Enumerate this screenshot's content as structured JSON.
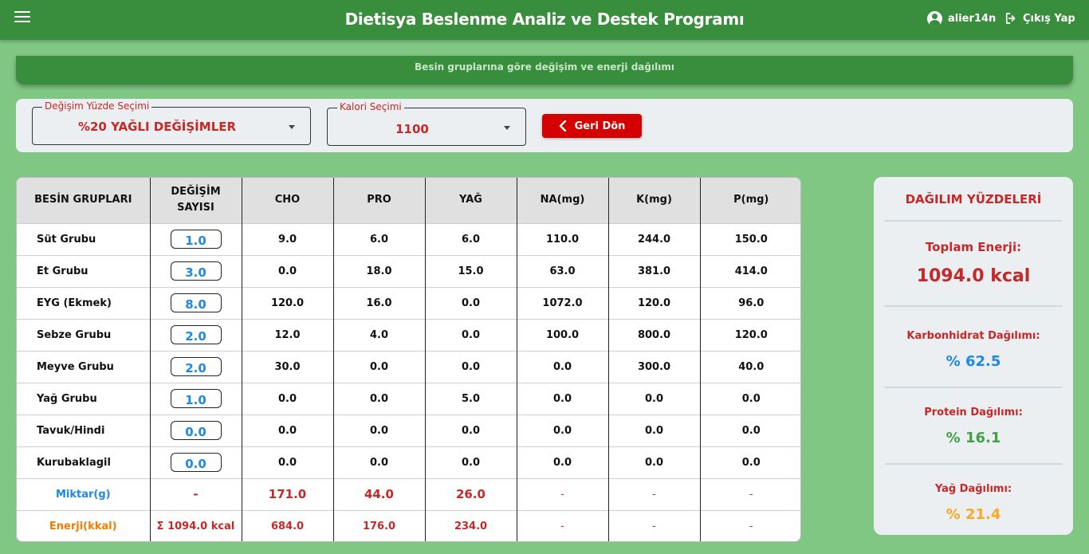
{
  "header": {
    "title": "Dietisya Beslenme Analiz ve Destek Programı",
    "username": "alier14n",
    "logout_label": "Çıkış Yap"
  },
  "banner": {
    "text": "Besin gruplarına göre değişim ve enerji dağılımı"
  },
  "controls": {
    "exchange_select": {
      "label": "Değişim Yüzde Seçimi",
      "value": "%20 YAĞLI DEĞİŞİMLER"
    },
    "calorie_select": {
      "label": "Kalori Seçimi",
      "value": "1100"
    },
    "back_label": "Geri Dön"
  },
  "table": {
    "columns": [
      "BESİN GRUPLARI",
      "DEĞİŞİM SAYISI",
      "CHO",
      "PRO",
      "YAĞ",
      "NA(mg)",
      "K(mg)",
      "P(mg)"
    ],
    "rows": [
      {
        "name": "Süt Grubu",
        "count": "1.0",
        "cho": "9.0",
        "pro": "6.0",
        "yag": "6.0",
        "na": "110.0",
        "k": "244.0",
        "p": "150.0"
      },
      {
        "name": "Et Grubu",
        "count": "3.0",
        "cho": "0.0",
        "pro": "18.0",
        "yag": "15.0",
        "na": "63.0",
        "k": "381.0",
        "p": "414.0"
      },
      {
        "name": "EYG (Ekmek)",
        "count": "8.0",
        "cho": "120.0",
        "pro": "16.0",
        "yag": "0.0",
        "na": "1072.0",
        "k": "120.0",
        "p": "96.0"
      },
      {
        "name": "Sebze Grubu",
        "count": "2.0",
        "cho": "12.0",
        "pro": "4.0",
        "yag": "0.0",
        "na": "100.0",
        "k": "800.0",
        "p": "120.0"
      },
      {
        "name": "Meyve Grubu",
        "count": "2.0",
        "cho": "30.0",
        "pro": "0.0",
        "yag": "0.0",
        "na": "0.0",
        "k": "300.0",
        "p": "40.0"
      },
      {
        "name": "Yağ Grubu",
        "count": "1.0",
        "cho": "0.0",
        "pro": "0.0",
        "yag": "5.0",
        "na": "0.0",
        "k": "0.0",
        "p": "0.0"
      },
      {
        "name": "Tavuk/Hindi",
        "count": "0.0",
        "cho": "0.0",
        "pro": "0.0",
        "yag": "0.0",
        "na": "0.0",
        "k": "0.0",
        "p": "0.0"
      },
      {
        "name": "Kurubaklagil",
        "count": "0.0",
        "cho": "0.0",
        "pro": "0.0",
        "yag": "0.0",
        "na": "0.0",
        "k": "0.0",
        "p": "0.0"
      }
    ],
    "amount_row": {
      "label": "Miktar(g)",
      "count": "-",
      "cho": "171.0",
      "pro": "44.0",
      "yag": "26.0",
      "na": "-",
      "k": "-",
      "p": "-"
    },
    "energy_row": {
      "label": "Enerji(kkal)",
      "count": "Σ 1094.0 kcal",
      "cho": "684.0",
      "pro": "176.0",
      "yag": "234.0",
      "na": "-",
      "k": "-",
      "p": "-"
    }
  },
  "distribution": {
    "title": "DAĞILIM YÜZDELERİ",
    "total_label": "Toplam Enerji:",
    "total_value": "1094.0 kcal",
    "carb_label": "Karbonhidrat Dağılımı:",
    "carb_value": "% 62.5",
    "protein_label": "Protein Dağılımı:",
    "protein_value": "% 16.1",
    "fat_label": "Yağ Dağılımı:",
    "fat_value": "% 21.4"
  },
  "colors": {
    "header_green": "#388e3c",
    "page_green": "#81c784",
    "accent_red": "#c62828",
    "button_red": "#d50000",
    "carb_blue": "#1e88e5",
    "protein_green": "#43a047",
    "fat_orange": "#f9a825"
  },
  "icons": [
    "menu-icon",
    "account-circle-icon",
    "logout-icon",
    "chevron-left-icon",
    "dropdown-arrow-icon"
  ]
}
